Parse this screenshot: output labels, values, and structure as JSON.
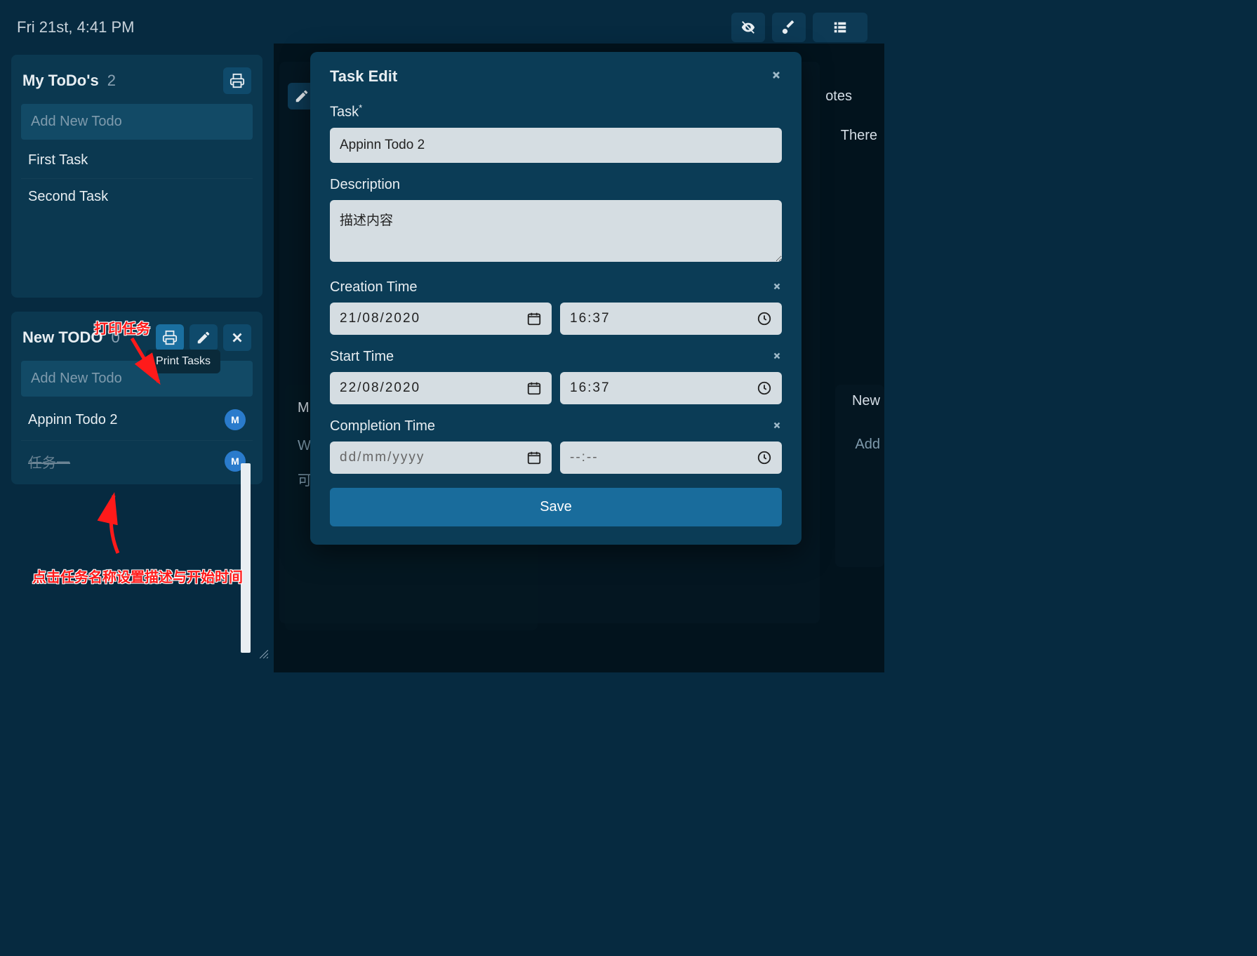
{
  "header": {
    "datetime": "Fri 21st, 4:41 PM"
  },
  "toolbar_icons": {
    "eye": "eye-slash-icon",
    "brush": "brush-icon",
    "list": "list-icon"
  },
  "panels": [
    {
      "title": "My ToDo's",
      "count": "2",
      "add_placeholder": "Add New Todo",
      "tasks": [
        {
          "label": "First Task",
          "done": false
        },
        {
          "label": "Second Task",
          "done": false
        }
      ]
    },
    {
      "title": "New TODO",
      "count": "0",
      "add_placeholder": "Add New Todo",
      "tooltip": "Print Tasks",
      "tasks": [
        {
          "label": "Appinn Todo 2",
          "badge": "M",
          "done": false
        },
        {
          "label": "任务一",
          "badge": "M",
          "done": true
        }
      ]
    }
  ],
  "annotations": {
    "print_label": "打印任务",
    "task_click_label": "点击任务名称设置描述与开始时间"
  },
  "background_peek": {
    "notes": "otes",
    "there": "There",
    "new": "New",
    "add": "Add",
    "m_initial": "M",
    "w_initial": "W",
    "cjk_char": "可"
  },
  "modal": {
    "title": "Task Edit",
    "task_label": "Task",
    "task_value": "Appinn Todo 2",
    "description_label": "Description",
    "description_value": "描述内容",
    "creation_time_label": "Creation Time",
    "creation_date": "21/08/2020",
    "creation_time": "16:37",
    "start_time_label": "Start Time",
    "start_date": "22/08/2020",
    "start_time": "16:37",
    "completion_time_label": "Completion Time",
    "completion_date_placeholder": "dd/mm/yyyy",
    "completion_time_placeholder": "--:--",
    "save_label": "Save"
  }
}
